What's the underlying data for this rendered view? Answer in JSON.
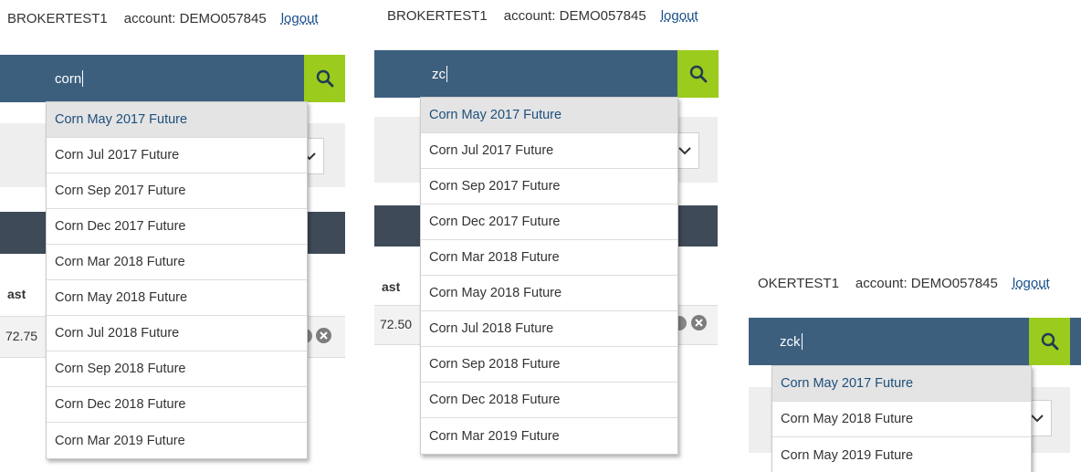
{
  "user": "BROKERTEST1",
  "account_label": "account: DEMO057845",
  "logout_label": "logout",
  "panels": [
    {
      "user_text": "BROKERTEST1",
      "search_value": "corn",
      "bg_last_label": "ast",
      "bg_last_value": "72.75",
      "results": [
        "Corn May 2017 Future",
        "Corn Jul 2017 Future",
        "Corn Sep 2017 Future",
        "Corn Dec 2017 Future",
        "Corn Mar 2018 Future",
        "Corn May 2018 Future",
        "Corn Jul 2018 Future",
        "Corn Sep 2018 Future",
        "Corn Dec 2018 Future",
        "Corn Mar 2019 Future"
      ]
    },
    {
      "user_text": "BROKERTEST1",
      "search_value": "zc",
      "bg_last_label": "ast",
      "bg_last_value": "72.50",
      "results": [
        "Corn May 2017 Future",
        "Corn Jul 2017 Future",
        "Corn Sep 2017 Future",
        "Corn Dec 2017 Future",
        "Corn Mar 2018 Future",
        "Corn May 2018 Future",
        "Corn Jul 2018 Future",
        "Corn Sep 2018 Future",
        "Corn Dec 2018 Future",
        "Corn Mar 2019 Future"
      ]
    },
    {
      "user_text": "OKERTEST1",
      "search_value": "zck",
      "results": [
        "Corn May 2017 Future",
        "Corn May 2018 Future",
        "Corn May 2019 Future"
      ]
    }
  ],
  "colors": {
    "search_bar": "#3d5f7e",
    "search_button": "#9bcb1c",
    "selected_item_bg": "#e4e4e4",
    "dark_header": "#3e4a57"
  }
}
